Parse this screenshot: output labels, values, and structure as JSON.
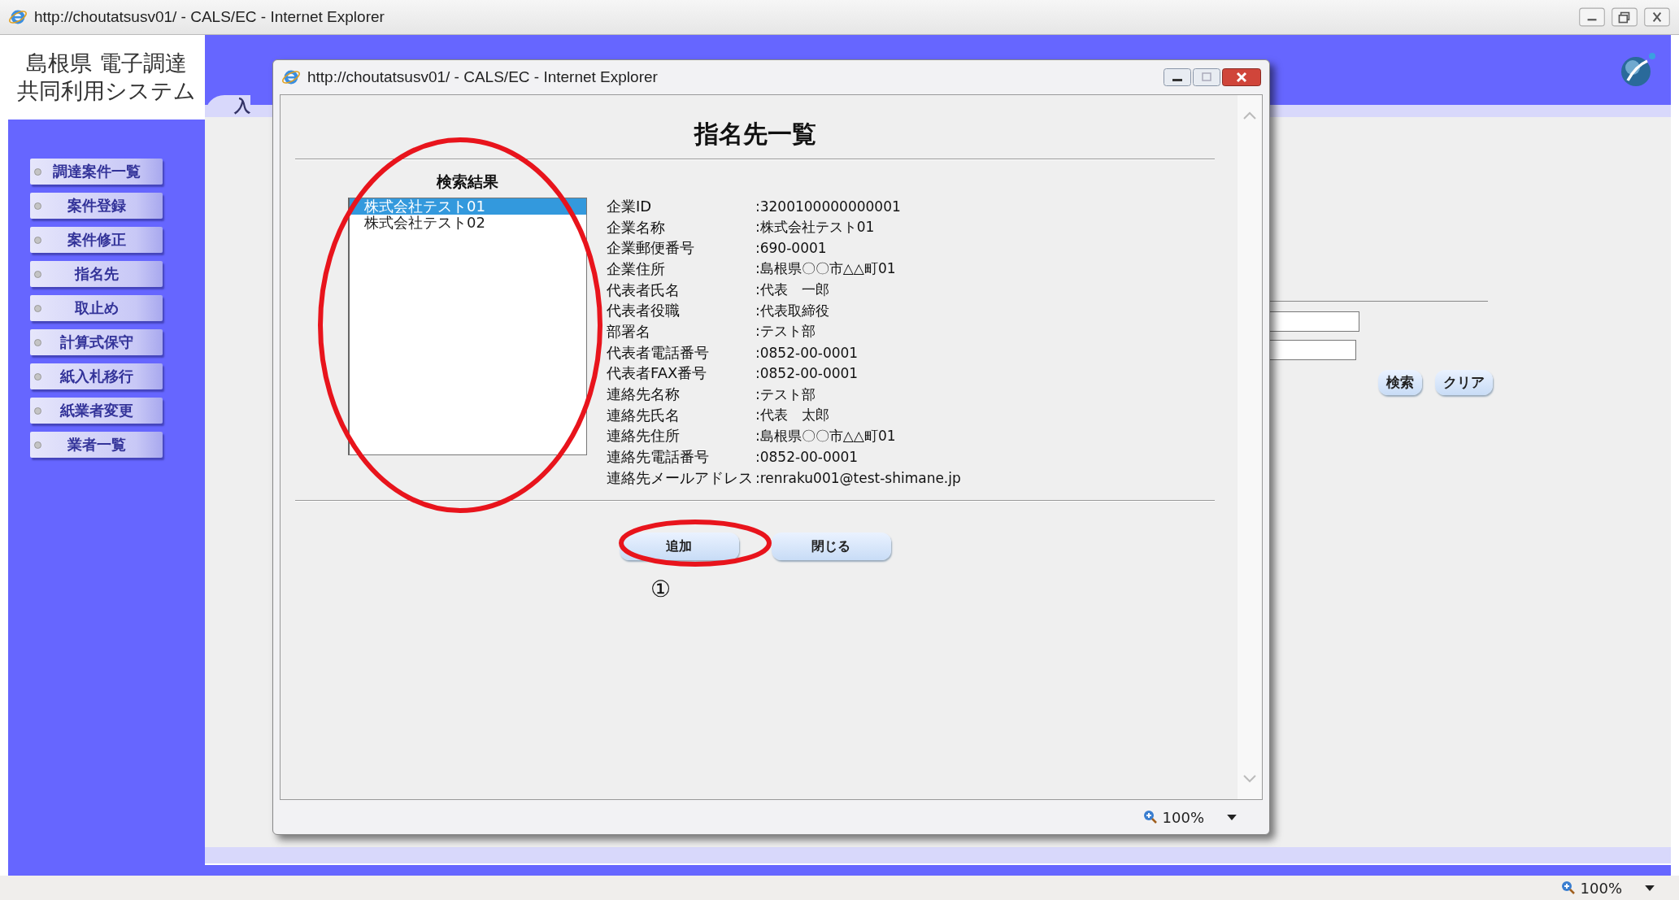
{
  "browser": {
    "title": "http://choutatsusv01/ - CALS/EC - Internet Explorer",
    "zoom": "100%"
  },
  "site": {
    "logo_lines": [
      "島根県 電子調達",
      "共同利用システム"
    ],
    "tab_label": "入"
  },
  "sidebar": {
    "items": [
      {
        "label": "調達案件一覧"
      },
      {
        "label": "案件登録"
      },
      {
        "label": "案件修正"
      },
      {
        "label": "指名先"
      },
      {
        "label": "取止め"
      },
      {
        "label": "計算式保守"
      },
      {
        "label": "紙入札移行"
      },
      {
        "label": "紙業者変更"
      },
      {
        "label": "業者一覧"
      }
    ]
  },
  "search_form": {
    "buttons": [
      "検索",
      "クリア"
    ]
  },
  "popup": {
    "title": "http://choutatsusv01/ - CALS/EC - Internet Explorer",
    "heading": "指名先一覧",
    "results_label": "検索結果",
    "results": [
      {
        "label": "株式会社テスト01",
        "selected": true
      },
      {
        "label": "株式会社テスト02",
        "selected": false
      }
    ],
    "details": [
      {
        "label": "企業ID",
        "value": ":3200100000000001"
      },
      {
        "label": "企業名称",
        "value": ":株式会社テスト01"
      },
      {
        "label": "企業郵便番号",
        "value": ":690-0001"
      },
      {
        "label": "企業住所",
        "value": ":島根県〇〇市△△町01"
      },
      {
        "label": "代表者氏名",
        "value": ":代表　一郎"
      },
      {
        "label": "代表者役職",
        "value": ":代表取締役"
      },
      {
        "label": "部署名",
        "value": ":テスト部"
      },
      {
        "label": "代表者電話番号",
        "value": ":0852-00-0001"
      },
      {
        "label": "代表者FAX番号",
        "value": ":0852-00-0001"
      },
      {
        "label": "連絡先名称",
        "value": ":テスト部"
      },
      {
        "label": "連絡先氏名",
        "value": ":代表　太郎"
      },
      {
        "label": "連絡先住所",
        "value": ":島根県〇〇市△△町01"
      },
      {
        "label": "連絡先電話番号",
        "value": ":0852-00-0001"
      },
      {
        "label": "連絡先メールアドレス",
        "value": ":renraku001@test-shimane.jp"
      }
    ],
    "buttons": [
      "追加",
      "閉じる"
    ],
    "zoom": "100%"
  },
  "annotations": {
    "step_marker": "①"
  }
}
